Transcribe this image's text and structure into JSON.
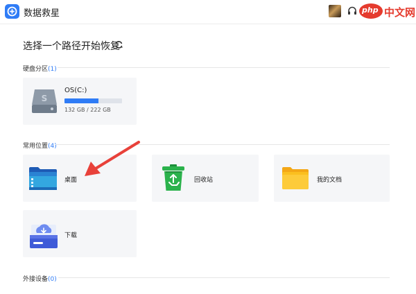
{
  "app": {
    "title": "数据救星"
  },
  "watermark": {
    "logo_text": "php",
    "site_text": "中文网"
  },
  "main": {
    "heading": "选择一个路径开始恢复"
  },
  "sections": {
    "disks": {
      "label": "硬盘分区",
      "count": "(1)"
    },
    "common": {
      "label": "常用位置",
      "count": "(4)"
    },
    "external": {
      "label": "外接设备",
      "count": "(0)"
    }
  },
  "disk": {
    "name": "OS(C:)",
    "size_text": "132 GB / 222 GB",
    "used_fraction": 0.595
  },
  "locations": {
    "desktop": "桌面",
    "recycle": "回收站",
    "documents": "我的文档",
    "downloads": "下载"
  },
  "colors": {
    "accent": "#2f7cf6",
    "annotation_arrow": "#e8413a",
    "folder_yellow": "#fbbf1f",
    "recycle_green": "#2bb24c"
  },
  "icons": {
    "logo": "plus-circle-icon",
    "support": "headset-icon",
    "refresh": "refresh-icon",
    "disk": "hard-drive-icon",
    "desktop": "desktop-folder-icon",
    "recycle": "recycle-bin-icon",
    "documents": "folder-icon",
    "downloads": "download-tray-icon"
  }
}
